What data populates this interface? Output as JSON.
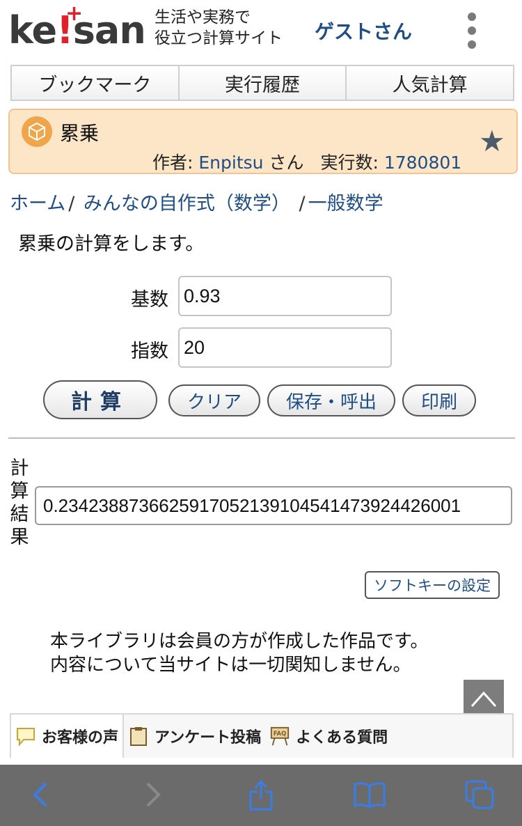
{
  "header": {
    "logo_text_1": "ke",
    "logo_text_bang": "!",
    "logo_text_2": "san",
    "logo_plus": "+",
    "tagline_line1": "生活や実務で",
    "tagline_line2": "役立つ計算サイト",
    "guest": "ゲストさん",
    "menu_icon": "kebab-menu-icon"
  },
  "tabs": [
    {
      "label": "ブックマーク"
    },
    {
      "label": "実行履歴"
    },
    {
      "label": "人気計算"
    }
  ],
  "title": {
    "name": "累乗",
    "author_label": "作者:",
    "author_name": "Enpitsu",
    "author_suffix": "さん",
    "runs_label": "実行数:",
    "runs_value": "1780801",
    "icon": "cube-icon",
    "bookmark_icon": "star-icon"
  },
  "breadcrumb": {
    "home": "ホーム",
    "sep": "/",
    "category": "みんなの自作式（数学）",
    "subcategory": "一般数学"
  },
  "description": "累乗の計算をします。",
  "form": {
    "base_label": "基数",
    "base_value": "0.93",
    "exp_label": "指数",
    "exp_value": "20"
  },
  "buttons": {
    "calc": "計算",
    "clear": "クリア",
    "save": "保存・呼出",
    "print": "印刷"
  },
  "result": {
    "label": "計算結果",
    "value": "0.2342388736625917052139104541473924426001"
  },
  "softkey_label": "ソフトキーの設定",
  "notice": {
    "line1": "本ライブラリは会員の方が作成した作品です。",
    "line2": "内容について当サイトは一切関知しません。"
  },
  "bottom_tabs": [
    {
      "label": "お客様の声",
      "icon": "speech-bubble-icon"
    },
    {
      "label": "アンケート投稿",
      "icon": "clipboard-icon"
    },
    {
      "label": "よくある質問",
      "icon": "faq-board-icon",
      "icon_text": "FAQ"
    }
  ],
  "colors": {
    "link": "#1f4e85",
    "title_bg": "#fde5c8",
    "accent_red": "#e0212a",
    "toolbar_bg": "#6b6b6b",
    "toolbar_icon": "#3b7de8"
  }
}
